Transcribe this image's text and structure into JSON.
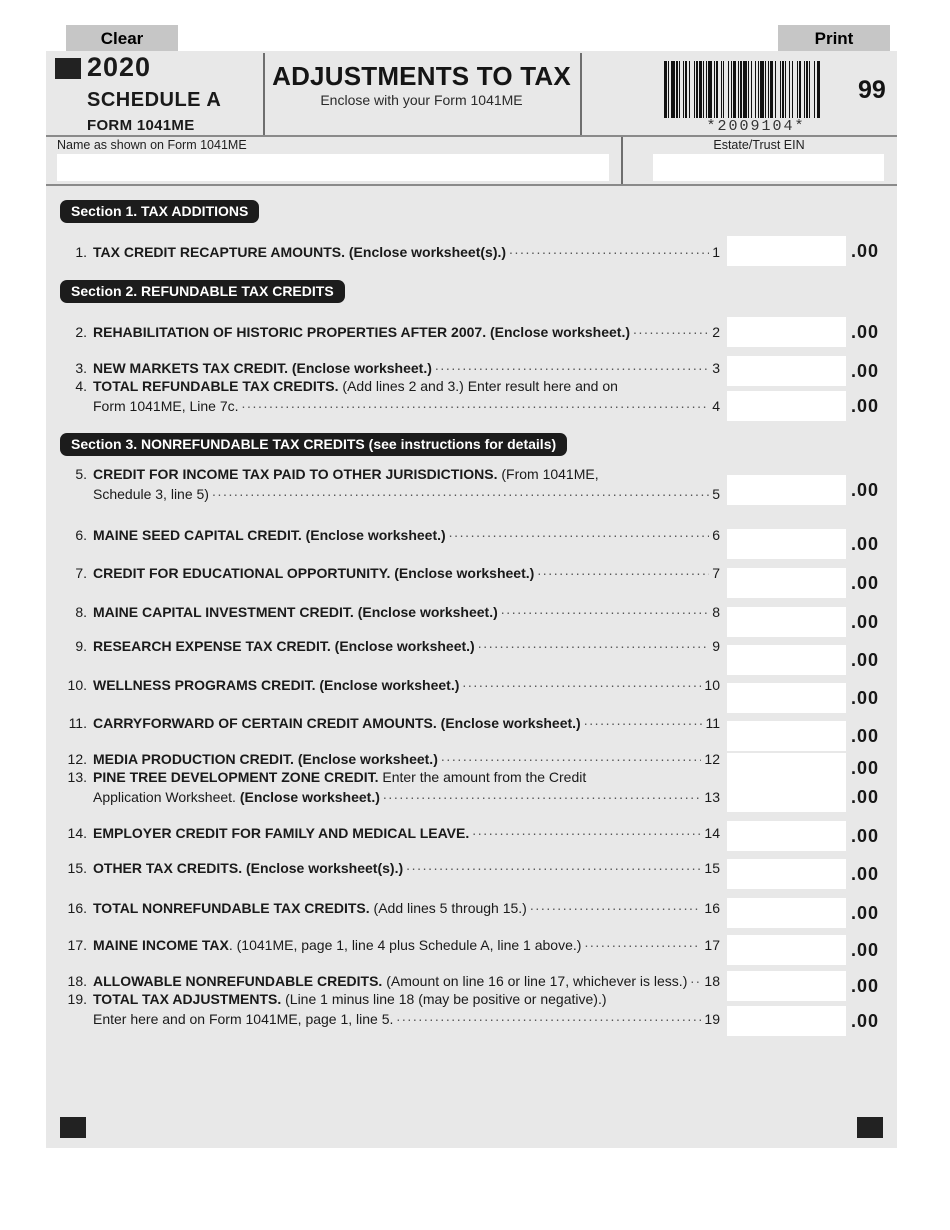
{
  "toolbar": {
    "clear_label": "Clear",
    "print_label": "Print"
  },
  "header": {
    "year": "2020",
    "schedule": "SCHEDULE A",
    "form_number": "FORM 1041ME",
    "title": "ADJUSTMENTS TO TAX",
    "subtitle": "Enclose with your Form 1041ME",
    "barcode_text": "*2009104*",
    "page_code": "99"
  },
  "identity": {
    "name_label": "Name as shown on Form 1041ME",
    "name_value": "",
    "name_placeholder": "",
    "ein_label": "Estate/Trust EIN",
    "ein_value": "",
    "ein_placeholder": ""
  },
  "sections": {
    "s1": "Section 1.  TAX ADDITIONS",
    "s2": "Section 2.  REFUNDABLE TAX CREDITS",
    "s3_main": "Section  3.  NONREFUNDABLE TAX CREDITS",
    "s3_note": " (see instructions for details)"
  },
  "cents_suffix": ".00",
  "lines": [
    {
      "num": "1.",
      "ref": "1",
      "rows": [
        {
          "bold": "TAX CREDIT RECAPTURE AMOUNTS. (Enclose worksheet(s).)",
          "plain": "",
          "leader": true,
          "ref": "1"
        }
      ],
      "value": "",
      "placeholder": ""
    },
    {
      "num": "2.",
      "ref": "2",
      "rows": [
        {
          "bold": "REHABILITATION OF HISTORIC PROPERTIES AFTER 2007. (Enclose worksheet.)",
          "plain": "",
          "leader": true,
          "ref": "2"
        }
      ],
      "value": "",
      "placeholder": ""
    },
    {
      "num": "3.",
      "ref": "3",
      "rows": [
        {
          "bold": "NEW MARKETS TAX CREDIT. (Enclose worksheet.)",
          "plain": "",
          "leader": true,
          "ref": "3"
        }
      ],
      "value": "",
      "placeholder": ""
    },
    {
      "num": "4.",
      "ref": "4",
      "rows": [
        {
          "bold": "TOTAL REFUNDABLE TAX CREDITS.",
          "plain": " (Add lines 2 and 3.) Enter result here and on",
          "leader": false,
          "ref": ""
        },
        {
          "bold": "",
          "plain": "Form 1041ME, Line 7c.",
          "leader": true,
          "ref": "4",
          "indent": true
        }
      ],
      "value": "",
      "placeholder": ""
    },
    {
      "num": "5.",
      "ref": "5",
      "rows": [
        {
          "bold": "CREDIT FOR INCOME TAX PAID TO OTHER JURISDICTIONS.",
          "plain": " (From 1041ME,",
          "leader": false,
          "ref": ""
        },
        {
          "bold": "",
          "plain": "Schedule 3, line 5)",
          "leader": true,
          "ref": "5",
          "indent": true
        }
      ],
      "value": "",
      "placeholder": ""
    },
    {
      "num": "6.",
      "ref": "6",
      "rows": [
        {
          "bold": "MAINE SEED CAPITAL CREDIT. (Enclose worksheet.)",
          "plain": "",
          "leader": true,
          "ref": "6"
        }
      ],
      "value": "",
      "placeholder": ""
    },
    {
      "num": "7.",
      "ref": "7",
      "rows": [
        {
          "bold": "CREDIT FOR EDUCATIONAL OPPORTUNITY. (Enclose worksheet.)",
          "plain": "",
          "leader": true,
          "ref": "7"
        }
      ],
      "value": "",
      "placeholder": ""
    },
    {
      "num": "8.",
      "ref": "8",
      "rows": [
        {
          "bold": "MAINE CAPITAL INVESTMENT CREDIT. (Enclose worksheet.)",
          "plain": "",
          "leader": true,
          "ref": "8"
        }
      ],
      "value": "",
      "placeholder": ""
    },
    {
      "num": "9.",
      "ref": "9",
      "rows": [
        {
          "bold": "RESEARCH EXPENSE TAX CREDIT. (Enclose worksheet.)",
          "plain": "",
          "leader": true,
          "ref": "9"
        }
      ],
      "value": "",
      "placeholder": ""
    },
    {
      "num": "10.",
      "ref": "10",
      "rows": [
        {
          "bold": "WELLNESS PROGRAMS CREDIT. (Enclose worksheet.)",
          "plain": "",
          "leader": true,
          "ref": "10"
        }
      ],
      "value": "",
      "placeholder": ""
    },
    {
      "num": "11.",
      "ref": "11",
      "rows": [
        {
          "bold": "CARRYFORWARD OF CERTAIN CREDIT AMOUNTS. (Enclose worksheet.)",
          "plain": "",
          "leader": true,
          "ref": "11"
        }
      ],
      "value": "",
      "placeholder": ""
    },
    {
      "num": "12.",
      "ref": "12",
      "rows": [
        {
          "bold": "MEDIA PRODUCTION CREDIT. (Enclose worksheet.)",
          "plain": "",
          "leader": true,
          "ref": "12"
        }
      ],
      "value": "",
      "placeholder": ""
    },
    {
      "num": "13.",
      "ref": "13",
      "rows": [
        {
          "bold": "PINE TREE DEVELOPMENT ZONE CREDIT.",
          "plain": " Enter the amount from the Credit",
          "leader": false,
          "ref": ""
        },
        {
          "bold": "",
          "plain": "Application Worksheet. ",
          "bold2": "(Enclose worksheet.)",
          "leader": true,
          "ref": "13",
          "indent": true
        }
      ],
      "value": "",
      "placeholder": ""
    },
    {
      "num": "14.",
      "ref": "14",
      "rows": [
        {
          "bold": "EMPLOYER CREDIT FOR FAMILY AND MEDICAL LEAVE.",
          "plain": "",
          "leader": true,
          "ref": "14"
        }
      ],
      "value": "",
      "placeholder": ""
    },
    {
      "num": "15.",
      "ref": "15",
      "rows": [
        {
          "bold": "OTHER TAX CREDITS. (Enclose worksheet(s).)",
          "plain": "",
          "leader": true,
          "ref": "15"
        }
      ],
      "value": "",
      "placeholder": ""
    },
    {
      "num": "16.",
      "ref": "16",
      "rows": [
        {
          "bold": "TOTAL NONREFUNDABLE TAX CREDITS.",
          "plain": " (Add lines 5 through 15.)",
          "leader": true,
          "ref": "16"
        }
      ],
      "value": "",
      "placeholder": ""
    },
    {
      "num": "17.",
      "ref": "17",
      "rows": [
        {
          "bold": "MAINE INCOME TAX",
          "plain": ". (1041ME, page 1, line 4 plus Schedule A, line 1 above.)",
          "leader": true,
          "ref": "17"
        }
      ],
      "value": "",
      "placeholder": ""
    },
    {
      "num": "18.",
      "ref": "18",
      "rows": [
        {
          "bold": "ALLOWABLE NONREFUNDABLE CREDITS.",
          "plain": " (Amount on line 16 or line 17, whichever is less.)",
          "leader": true,
          "ref": "18"
        }
      ],
      "value": "",
      "placeholder": ""
    },
    {
      "num": "19.",
      "ref": "19",
      "rows": [
        {
          "bold": "TOTAL TAX ADJUSTMENTS.",
          "plain": " (Line 1 minus line 18 (may be positive or negative).)",
          "leader": false,
          "ref": ""
        },
        {
          "bold": "",
          "plain": "Enter here and on Form 1041ME, page 1, line 5.",
          "leader": true,
          "ref": "19",
          "indent": true
        }
      ],
      "value": "",
      "placeholder": ""
    }
  ],
  "layout": {
    "section_tops": {
      "s1": 149,
      "s2": 229,
      "s3": 382
    },
    "line_tops": [
      192,
      272,
      308,
      327,
      415,
      475,
      513,
      552,
      586,
      625,
      663,
      699,
      718,
      773,
      808,
      848,
      885,
      921,
      940
    ],
    "amount_tops": [
      185,
      266,
      305,
      340,
      424,
      478,
      517,
      556,
      594,
      632,
      670,
      702,
      731,
      770,
      808,
      847,
      884,
      920,
      955
    ]
  }
}
